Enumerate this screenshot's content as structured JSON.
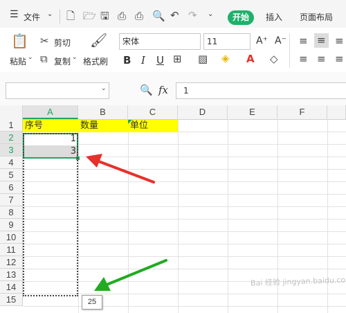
{
  "menu": {
    "file_label": "文件",
    "tabs": [
      "开始",
      "插入",
      "页面布局"
    ]
  },
  "toolbar": {
    "paste_label": "粘贴",
    "cut_label": "剪切",
    "copy_label": "复制",
    "format_painter_label": "格式刷",
    "font_name": "宋体",
    "font_size": "11",
    "increase_font_label": "A⁺",
    "decrease_font_label": "A⁻"
  },
  "formula_bar": {
    "name_box_value": "",
    "fx_label": "fx",
    "formula_value": "1"
  },
  "sheet": {
    "columns": [
      "A",
      "B",
      "C",
      "D",
      "E",
      "F"
    ],
    "rows": [
      "1",
      "2",
      "3",
      "4",
      "5",
      "6",
      "7",
      "8",
      "9",
      "10",
      "11",
      "12",
      "13",
      "14",
      "15"
    ],
    "header_row": {
      "A1": "序号",
      "B1": "数量",
      "C1": "单位"
    },
    "values": {
      "A2": "1",
      "A3": "3"
    },
    "fill_tooltip": "25",
    "header_fill_color": "#ffff00",
    "accent_color": "#1fa463",
    "arrow_colors": {
      "red": "#e8302c",
      "green": "#22aa22"
    }
  },
  "watermark": "Bai 经验 jingyan.baidu.com"
}
